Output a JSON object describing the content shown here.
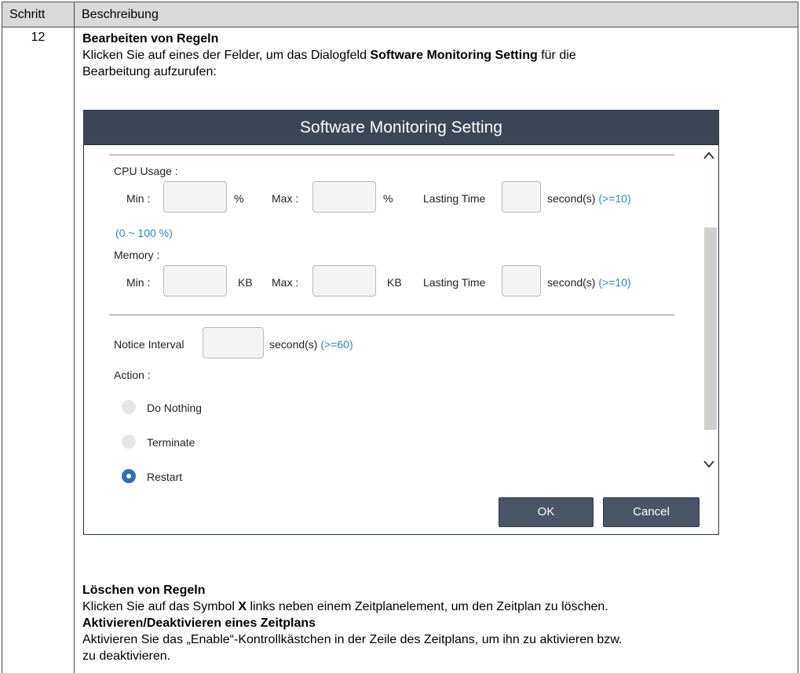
{
  "table": {
    "header_step": "Schritt",
    "header_desc": "Beschreibung",
    "step_number": "12"
  },
  "section1": {
    "heading": "Bearbeiten von Regeln",
    "line1_pre": "Klicken Sie auf eines der Felder, um das Dialogfeld ",
    "line1_bold": "Software Monitoring Setting",
    "line1_post": " für die",
    "line2": "Bearbeitung aufzurufen:"
  },
  "dialog": {
    "title": "Software Monitoring Setting",
    "cpu_label": "CPU Usage :",
    "min_label": "Min :",
    "max_label": "Max :",
    "percent": "%",
    "kb": "KB",
    "lasting_time": "Lasting Time",
    "seconds": "second(s)",
    "hint_ge10": "(>=10)",
    "cpu_range": "(0 ~ 100 %)",
    "memory_label": "Memory :",
    "notice_interval": "Notice Interval",
    "hint_ge60": "(>=60)",
    "action_label": "Action :",
    "actions": [
      "Do Nothing",
      "Terminate",
      "Restart"
    ],
    "selected_action": "Restart",
    "ok": "OK",
    "cancel": "Cancel",
    "scroll_up": "^",
    "scroll_down": "v"
  },
  "section2": {
    "heading": "Löschen von Regeln",
    "line_pre": "Klicken Sie auf das Symbol ",
    "line_bold": "X",
    "line_post": " links neben einem Zeitplanelement, um den Zeitplan zu löschen."
  },
  "section3": {
    "heading": "Aktivieren/Deaktivieren eines Zeitplans",
    "line1": "Aktivieren Sie das „Enable“-Kontrollkästchen in der Zeile des Zeitplans, um ihn zu aktivieren bzw.",
    "line2": "zu deaktivieren."
  }
}
